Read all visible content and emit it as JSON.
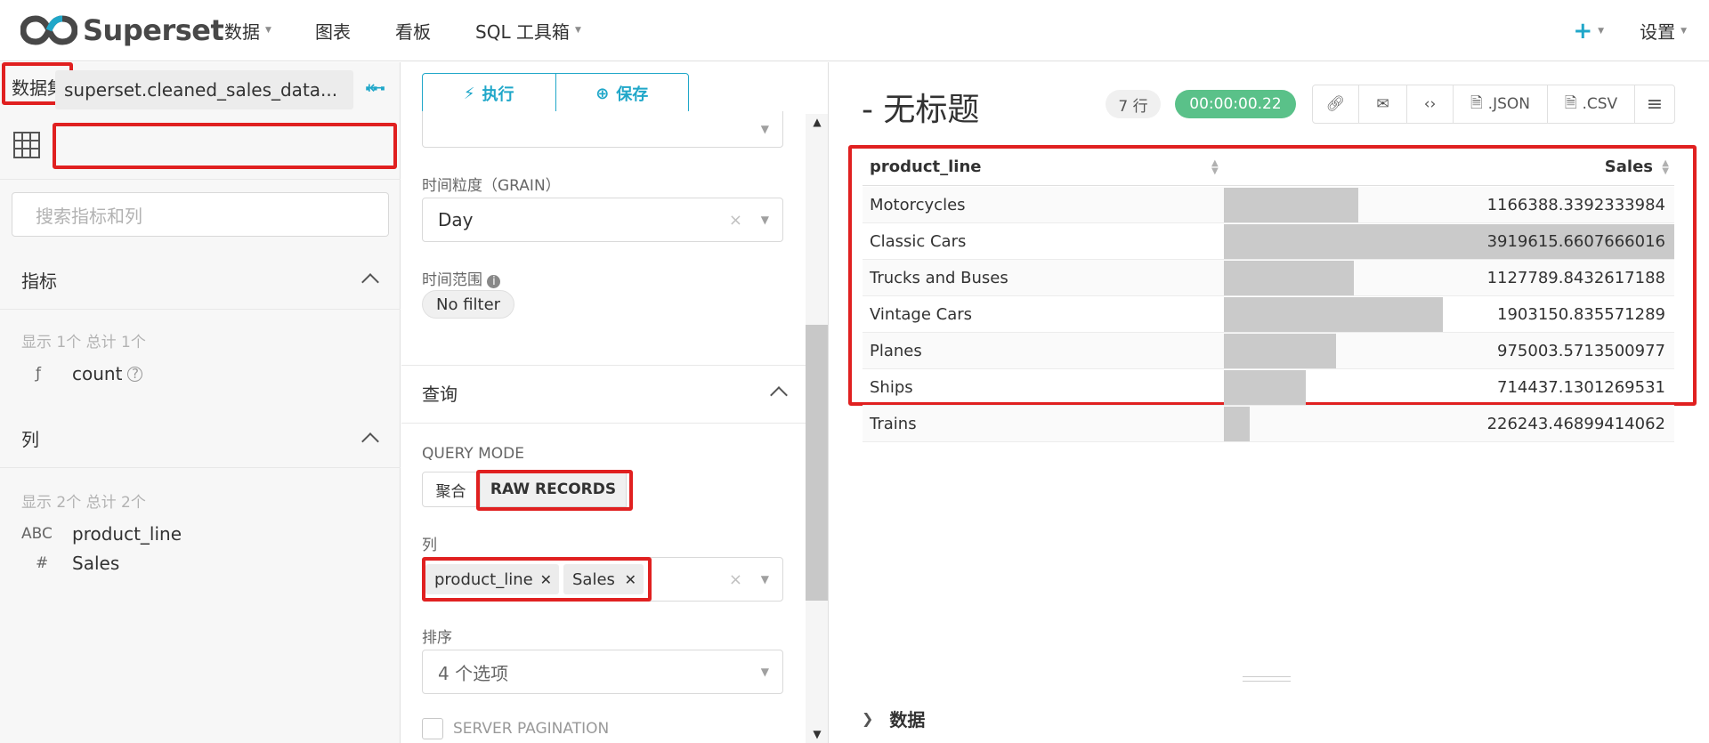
{
  "nav": {
    "brand": "Superset",
    "items": [
      {
        "label": "数据",
        "has_caret": true
      },
      {
        "label": "图表",
        "has_caret": false
      },
      {
        "label": "看板",
        "has_caret": false
      },
      {
        "label": "SQL 工具箱",
        "has_caret": true
      }
    ],
    "plus_label": "+",
    "settings_label": "设置"
  },
  "left": {
    "dataset_title": "数据集",
    "datasource_name": "superset.cleaned_sales_data...",
    "more_label": "···",
    "search_placeholder": "搜索指标和列",
    "metrics": {
      "title": "指标",
      "summary": "显示 1个 总计 1个",
      "items": [
        {
          "type": "ƒ",
          "name": "count"
        }
      ]
    },
    "columns": {
      "title": "列",
      "summary": "显示 2个 总计 2个",
      "items": [
        {
          "type": "ABC",
          "name": "product_line"
        },
        {
          "type": "#",
          "name": "Sales"
        }
      ]
    }
  },
  "middle": {
    "run_label": "执行",
    "save_label": "保存",
    "grain_label": "时间粒度（GRAIN）",
    "grain_value": "Day",
    "range_label": "时间范围",
    "range_value": "No filter",
    "query_section": "查询",
    "query_mode_label": "QUERY MODE",
    "mode_aggregate": "聚合",
    "mode_raw": "RAW RECORDS",
    "columns_label": "列",
    "column_tags": [
      "product_line",
      "Sales"
    ],
    "sort_label": "排序",
    "sort_value": "4 个选项",
    "server_pagination_label": "SERVER PAGINATION"
  },
  "right": {
    "title": "- 无标题",
    "row_count": "7 行",
    "timer": "00:00:00.22",
    "toolbar": {
      "json": ".JSON",
      "csv": ".CSV"
    },
    "data_section": "数据"
  },
  "colors": {
    "accent": "#20a7c9",
    "success": "#5ac189",
    "highlight": "#e02020",
    "bar": "#cacaca"
  },
  "chart_data": {
    "type": "table",
    "columns": [
      "product_line",
      "Sales"
    ],
    "rows": [
      {
        "product_line": "Motorcycles",
        "Sales": "1166388.3392333984",
        "value": 1166388.3392333984
      },
      {
        "product_line": "Classic Cars",
        "Sales": "3919615.6607666016",
        "value": 3919615.6607666016
      },
      {
        "product_line": "Trucks and Buses",
        "Sales": "1127789.8432617188",
        "value": 1127789.8432617188
      },
      {
        "product_line": "Vintage Cars",
        "Sales": "1903150.835571289",
        "value": 1903150.835571289
      },
      {
        "product_line": "Planes",
        "Sales": "975003.5713500977",
        "value": 975003.5713500977
      },
      {
        "product_line": "Ships",
        "Sales": "714437.1301269531",
        "value": 714437.1301269531
      },
      {
        "product_line": "Trains",
        "Sales": "226243.46899414062",
        "value": 226243.46899414062
      }
    ]
  }
}
